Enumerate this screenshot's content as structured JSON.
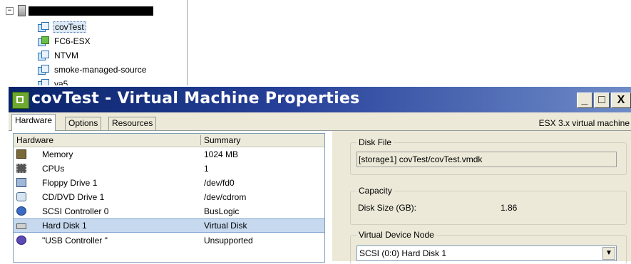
{
  "tree": {
    "toggle": "−",
    "vms": [
      {
        "label": "covTest",
        "selected": true
      },
      {
        "label": "FC6-ESX",
        "selected": false
      },
      {
        "label": "NTVM",
        "selected": false
      },
      {
        "label": "smoke-managed-source",
        "selected": false
      },
      {
        "label": "va5",
        "selected": false
      }
    ]
  },
  "dialog": {
    "title": "covTest - Virtual Machine Properties",
    "buttons": {
      "minimize": "_",
      "maximize": "□",
      "close": "X"
    },
    "tabs": [
      "Hardware",
      "Options",
      "Resources"
    ],
    "esx_version": "ESX 3.x virtual machine",
    "hardware_table": {
      "columns": [
        "Hardware",
        "Summary"
      ],
      "rows": [
        {
          "name": "Memory",
          "summary": "1024 MB",
          "icon": "memory-icon"
        },
        {
          "name": "CPUs",
          "summary": "1",
          "icon": "cpu-icon"
        },
        {
          "name": "Floppy Drive 1",
          "summary": "/dev/fd0",
          "icon": "floppy-icon"
        },
        {
          "name": "CD/DVD Drive 1",
          "summary": "/dev/cdrom",
          "icon": "cdrom-icon"
        },
        {
          "name": "SCSI Controller 0",
          "summary": "BusLogic",
          "icon": "scsi-icon"
        },
        {
          "name": "Hard Disk 1",
          "summary": "Virtual Disk",
          "icon": "harddisk-icon",
          "selected": true
        },
        {
          "name": "\"USB Controller \"",
          "summary": "Unsupported",
          "icon": "usb-icon"
        }
      ]
    },
    "disk_file": {
      "legend": "Disk File",
      "value": "[storage1] covTest/covTest.vmdk"
    },
    "capacity": {
      "legend": "Capacity",
      "label": "Disk Size (GB):",
      "value": "1.86"
    },
    "virtual_device_node": {
      "legend": "Virtual Device Node",
      "selected": "SCSI (0:0) Hard Disk 1"
    }
  },
  "colors": {
    "title_bar_start": "#0a246a",
    "title_bar_end": "#6f8cc8",
    "selection": "#c6d9ef",
    "dialog_bg": "#ece9d8"
  }
}
